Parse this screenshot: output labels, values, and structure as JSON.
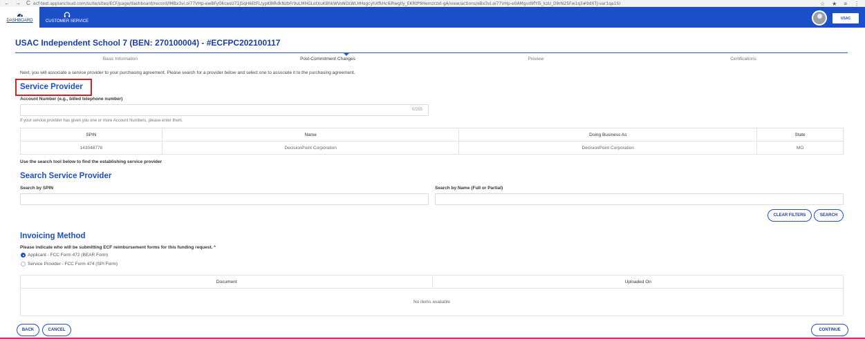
{
  "browser": {
    "url": "ecf-test.appiancloud.com/suite/sites/ECF/page/dashboard/record/lMBx3vi.oi77VHp-ewBFyOkcesU71JSqH6EtFL/ypK8IRdkNzbFr9uLMHGLotXuK8hkWVoNOLWLHHsgcyhXfkHc6iRwgIly_EKRtP9Hemzrzxl-gA/view/actions/eBx3vi.oi77VHp-e0AMgvd9fYl5_kzU_D9rN25Fw1q3#9dXTJ-var1qa1SI",
    "nav_back": "←",
    "nav_forward": "→",
    "nav_reload": "C",
    "right_icons": [
      "☆",
      "★",
      "≡",
      "⋮"
    ]
  },
  "appbar": {
    "dashboard_label": "DASHBOARD",
    "dashboard_icon": "dashboard-icon",
    "customer_service_label": "CUSTOMER SERVICE",
    "customer_service_icon": "headset-icon",
    "logo_text": "USAC"
  },
  "page_title": "USAC Independent School 7 (BEN: 270100004) - #ECFPC202100117",
  "steps": [
    {
      "label": "Basic Information",
      "active": false
    },
    {
      "label": "Post-Commitment Changes",
      "active": true
    },
    {
      "label": "Preview",
      "active": false
    },
    {
      "label": "Certifications",
      "active": false
    }
  ],
  "intro_text": "Next, you will associate a service provider to your purchasing agreement. Please search for a provider below and select one to associate it to the purchasing agreement.",
  "service_provider": {
    "title": "Service Provider",
    "account_label": "Account Number (e.g., billed telephone number)",
    "account_value": "",
    "account_counter": "0/255",
    "account_hint": "If your service provider has given you one or more Account Numbers, please enter them.",
    "table": {
      "headers": [
        "SPIN",
        "Name",
        "Doing Business As",
        "State"
      ],
      "rows": [
        [
          "143048778",
          "DecisionPoint Corporation",
          "DecisionPoint Corporation",
          "MO"
        ]
      ]
    },
    "search_tool_text": "Use the search tool below to find the establishing service provider"
  },
  "search": {
    "title": "Search Service Provider",
    "spin_label": "Search by SPIN",
    "name_label": "Search by Name (Full or Partial)",
    "spin_value": "",
    "name_value": "",
    "clear_filters_label": "CLEAR FILTERS",
    "search_label": "SEARCH"
  },
  "invoicing": {
    "title": "Invoicing Method",
    "question": "Please indicate who will be submitting ECF reimbursement forms for this funding request.",
    "required_mark": "*",
    "options": [
      {
        "label": "Applicant - FCC Form 472 (BEAR Form)",
        "selected": true
      },
      {
        "label": "Service Provider - FCC Form 474 (SPI Form)",
        "selected": false
      }
    ],
    "table": {
      "headers": [
        "Document",
        "Uploaded On"
      ],
      "empty_text": "No items available"
    }
  },
  "footer": {
    "back_label": "BACK",
    "cancel_label": "CANCEL",
    "continue_label": "CONTINUE"
  },
  "colors": {
    "brand_blue": "#1b50c8",
    "title_blue": "#1a3e9a",
    "highlight_red": "#d91e1e"
  }
}
